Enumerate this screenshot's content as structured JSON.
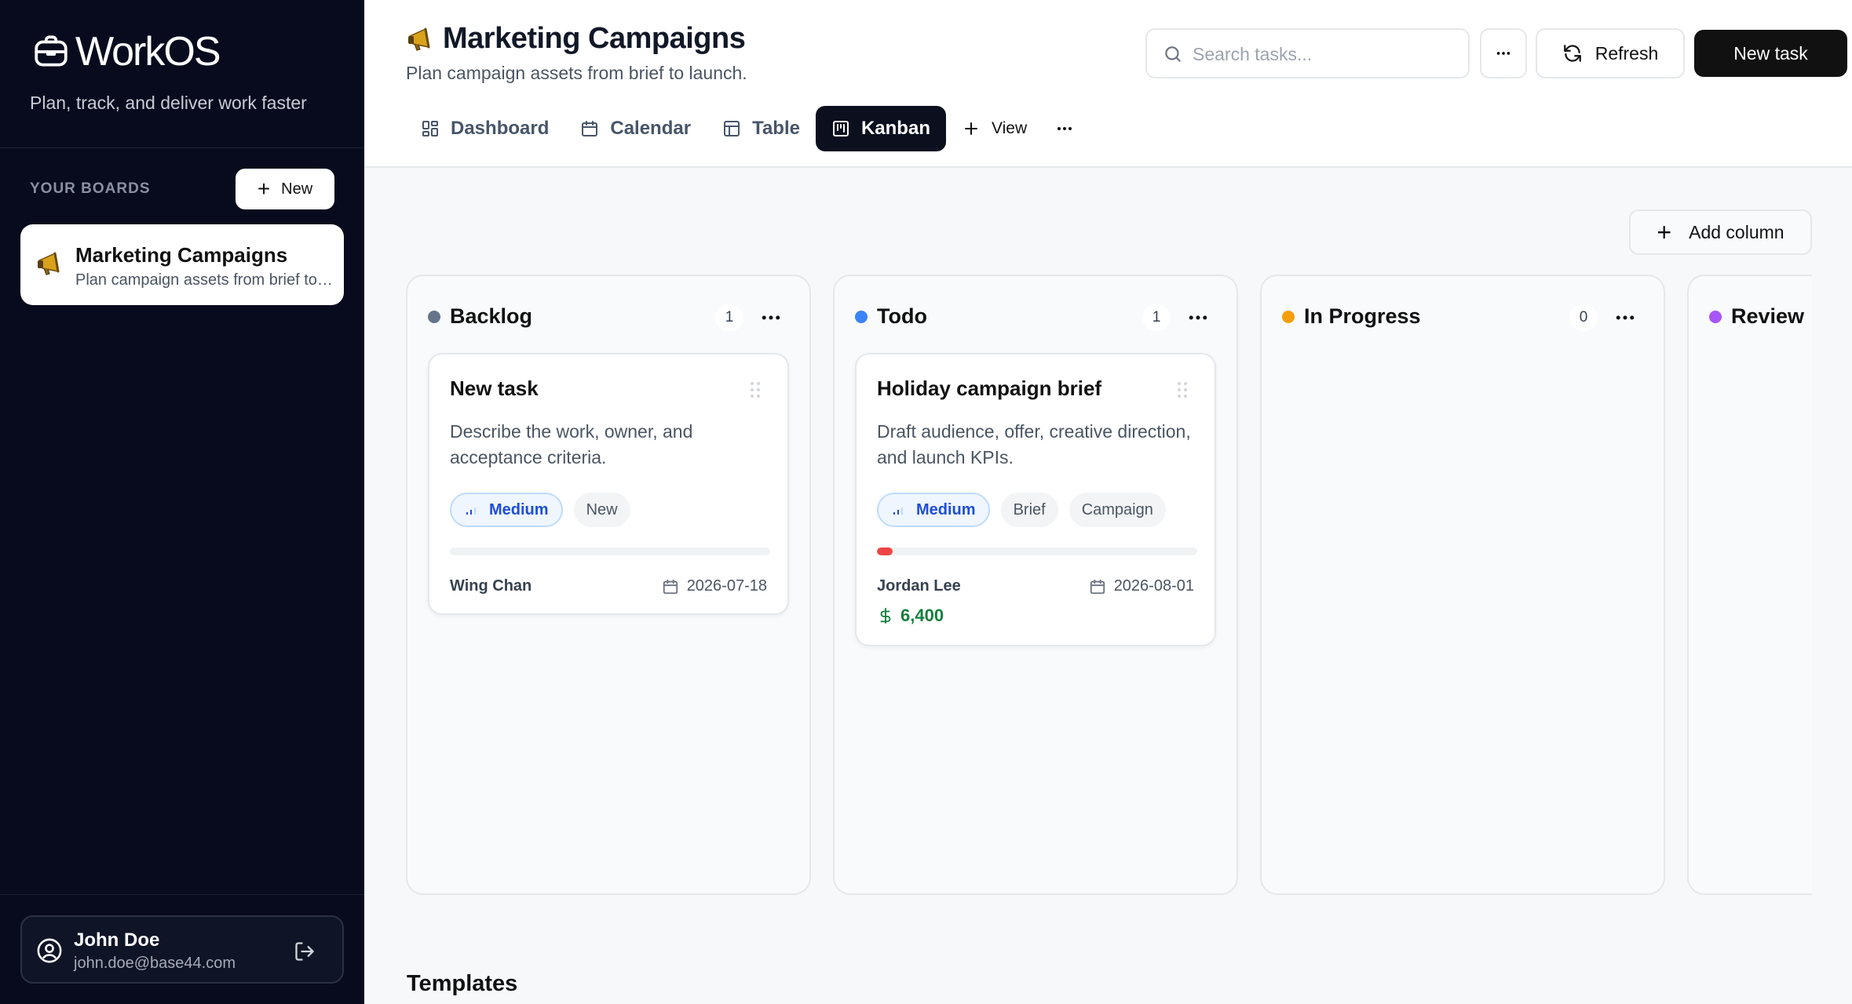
{
  "app": {
    "brand": "WorkOS",
    "tagline": "Plan, track, and deliver work faster"
  },
  "sidebar": {
    "section_label": "YOUR BOARDS",
    "new_label": "New",
    "boards": [
      {
        "name": "Marketing Campaigns",
        "description": "Plan campaign assets from brief to launch."
      }
    ],
    "user": {
      "name": "John Doe",
      "email": "john.doe@base44.com"
    }
  },
  "header": {
    "title": "Marketing Campaigns",
    "subtitle": "Plan campaign assets from brief to launch.",
    "search_placeholder": "Search tasks...",
    "refresh_label": "Refresh",
    "new_task_label": "New task"
  },
  "tabs": [
    {
      "label": "Dashboard",
      "icon": "dashboard-icon",
      "active": false
    },
    {
      "label": "Calendar",
      "icon": "calendar-icon",
      "active": false
    },
    {
      "label": "Table",
      "icon": "table-icon",
      "active": false
    },
    {
      "label": "Kanban",
      "icon": "kanban-icon",
      "active": true
    }
  ],
  "view_label": "View",
  "board": {
    "add_column_label": "Add column",
    "columns": [
      {
        "title": "Backlog",
        "count": "1",
        "color": "#64748b",
        "cards": [
          {
            "title": "New task",
            "description": "Describe the work, owner, and acceptance criteria.",
            "priority": "Medium",
            "tags": [
              "New"
            ],
            "progress": 0,
            "assignee": "Wing Chan",
            "due": "2026-07-18",
            "budget": ""
          }
        ]
      },
      {
        "title": "Todo",
        "count": "1",
        "color": "#3b82f6",
        "cards": [
          {
            "title": "Holiday campaign brief",
            "description": "Draft audience, offer, creative direction, and launch KPIs.",
            "priority": "Medium",
            "tags": [
              "Brief",
              "Campaign"
            ],
            "progress": 5,
            "assignee": "Jordan Lee",
            "due": "2026-08-01",
            "budget": "6,400"
          }
        ]
      },
      {
        "title": "In Progress",
        "count": "0",
        "color": "#f59e0b",
        "cards": []
      },
      {
        "title": "Review",
        "count": "",
        "color": "#a855f7",
        "cards": []
      }
    ]
  },
  "templates_heading": "Templates"
}
